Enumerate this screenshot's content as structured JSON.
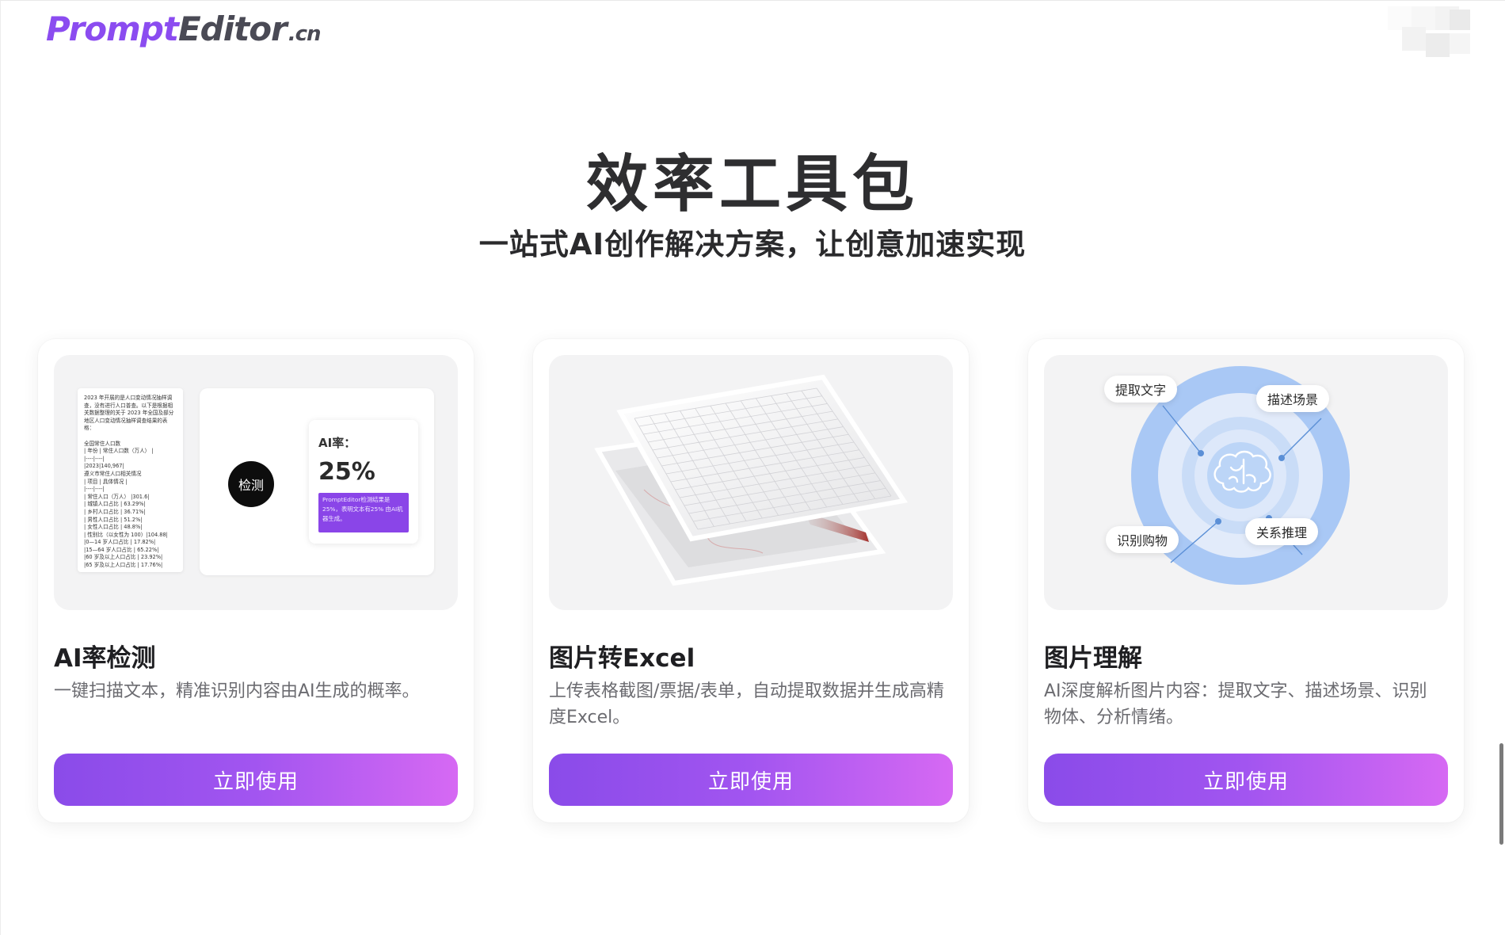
{
  "header": {
    "logo_prompt": "Prompt",
    "logo_editor": "Editor",
    "logo_cn": ".cn"
  },
  "hero": {
    "title": "效率工具包",
    "subtitle": "一站式AI创作解决方案，让创意加速实现"
  },
  "cards": [
    {
      "title": "AI率检测",
      "description": "一键扫描文本，精准识别内容由AI生成的概率。",
      "button": "立即使用",
      "preview": {
        "detect_label": "检测",
        "ai_rate_label": "AI率：",
        "ai_rate_value": "25%",
        "ai_rate_note": "PromptEditor检测结果是25%，表明文本有25% 由AI机器生成。",
        "doc_lines": [
          "2023 年开展的是人口变动情况抽样调",
          "查，没有进行人口普查。以下是根据相",
          "关数据整理的关于 2023 年全国及部分",
          "地区人口变动情况抽样调查结果的表",
          "格：",
          "",
          "全国常住人口数",
          "| 年份 | 常住人口数（万人） |",
          "|----|----|",
          "|2023|140,967|",
          "遵义市常住人口相关情况",
          "| 项目 | 具体情况 |",
          "|----|----|",
          "| 常住人口（万人） |301.6|",
          "| 城镇人口占比 | 63.29%|",
          "| 乡村人口占比 | 36.71%|",
          "| 男性人口占比 | 51.2%|",
          "| 女性人口占比 | 48.8%|",
          "| 性别比（以女性为 100）|104.88|",
          "|0—14 岁人口占比 | 17.82%|",
          "|15—64 岁人口占比 | 65.22%|",
          "|60 岁及以上人口占比 | 23.92%|",
          "|65 岁及以上人口占比 | 17.76%|"
        ]
      }
    },
    {
      "title": "图片转Excel",
      "description": "上传表格截图/票据/表单，自动提取数据并生成高精度Excel。",
      "button": "立即使用"
    },
    {
      "title": "图片理解",
      "description": "AI深度解析图片内容：提取文字、描述场景、识别物体、分析情绪。",
      "button": "立即使用",
      "preview": {
        "tags": [
          "提取文字",
          "描述场景",
          "识别购物",
          "关系推理"
        ]
      }
    }
  ],
  "colors": {
    "brand_purple": "#8b4cf0",
    "button_gradient_start": "#8a4be9",
    "button_gradient_end": "#d669f3",
    "ring_blue": "#a9c8f5"
  }
}
